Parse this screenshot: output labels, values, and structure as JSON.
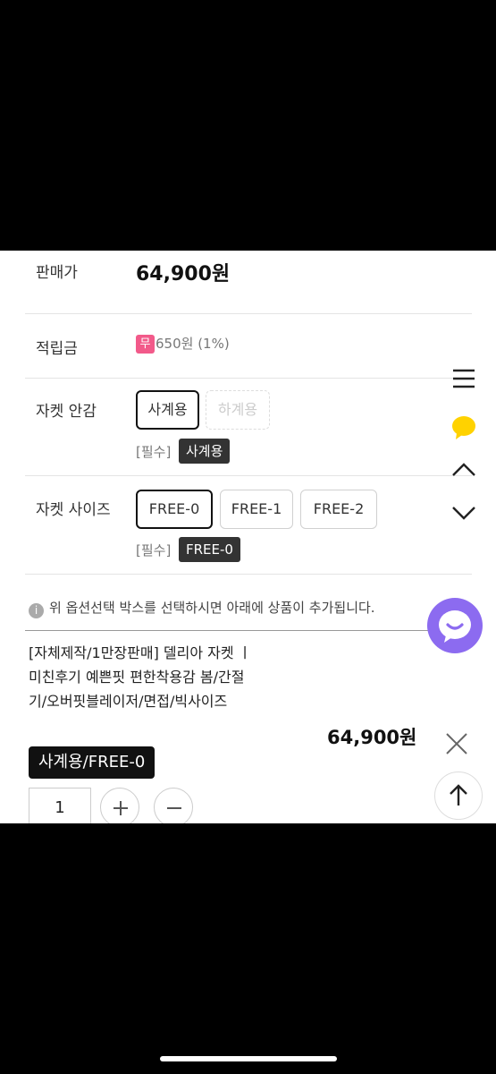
{
  "price": {
    "label": "판매가",
    "value": "64,900원"
  },
  "points": {
    "label": "적립금",
    "badge": "무",
    "value": "650원 (1%)"
  },
  "lining": {
    "label": "자켓 안감",
    "options": [
      "사계용",
      "하계용"
    ],
    "selected": "사계용",
    "required": "[필수]"
  },
  "size": {
    "label": "자켓 사이즈",
    "options": [
      "FREE-0",
      "FREE-1",
      "FREE-2"
    ],
    "selected": "FREE-0",
    "required": "[필수]"
  },
  "notice": {
    "icon": "info-icon",
    "text": "위 옵션선택 박스를 선택하시면 아래에 상품이 추가됩니다."
  },
  "selection": {
    "title": "[자체제작/1만장판매] 델리아 자켓 ㅣ미친후기 예쁜핏 편한착용감 봄/간절기/오버핏블레이저/면접/빅사이즈",
    "option": "사계용/FREE-0",
    "price": "64,900원",
    "quantity": "1"
  },
  "colors": {
    "badge": "#f25a8a",
    "chat": "#8c6bf0",
    "chat_bubble": "#ffd200"
  }
}
